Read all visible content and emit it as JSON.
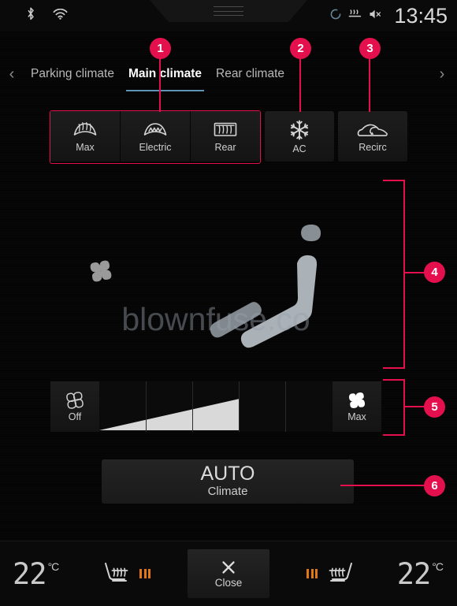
{
  "status_bar": {
    "bluetooth_icon": "bluetooth-icon",
    "wifi_icon": "wifi-icon",
    "circle_icon": "circle-progress-icon",
    "defrost_icon": "rear-defrost-icon",
    "mute_icon": "volume-muted-icon",
    "clock": "13:45",
    "handle_icon": "drag-handle-icon"
  },
  "tab_bar": {
    "prev_arrow": "‹",
    "next_arrow": "›",
    "tabs": [
      {
        "label": "Parking climate",
        "active": false
      },
      {
        "label": "Main climate",
        "active": true
      },
      {
        "label": "Rear climate",
        "active": false
      }
    ]
  },
  "mode_buttons": {
    "group_defrost": [
      {
        "label": "Max",
        "icon": "max-defrost-icon"
      },
      {
        "label": "Electric",
        "icon": "electric-defrost-icon"
      },
      {
        "label": "Rear",
        "icon": "rear-window-defrost-icon"
      }
    ],
    "ac": {
      "label": "AC",
      "icon": "snowflake-icon"
    },
    "recirc": {
      "label": "Recirc",
      "icon": "air-recirculation-icon"
    }
  },
  "airflow": {
    "fan_icon": "fan-icon",
    "seat_icon": "seat-silhouette-icon",
    "stream_count": 3,
    "watermark": "blownfuse.co"
  },
  "fan_slider": {
    "off_label": "Off",
    "off_icon": "fan-outline-icon",
    "max_label": "Max",
    "max_icon": "fan-solid-icon",
    "segments": 5,
    "filled_segments": 3
  },
  "auto_button": {
    "title": "AUTO",
    "subtitle": "Climate"
  },
  "bottom_bar": {
    "left_temp": "22",
    "left_unit": "°C",
    "right_temp": "22",
    "right_unit": "°C",
    "left_seat_icon": "heated-seat-left-icon",
    "right_seat_icon": "heated-seat-right-icon",
    "left_seat_level": 3,
    "right_seat_level": 3,
    "close_label": "Close",
    "close_icon": "close-x-icon"
  },
  "callouts": [
    {
      "number": "1"
    },
    {
      "number": "2"
    },
    {
      "number": "3"
    },
    {
      "number": "4"
    },
    {
      "number": "5"
    },
    {
      "number": "6"
    }
  ],
  "colors": {
    "accent": "#e4104e",
    "tab_underline": "#5d93b4",
    "seat_heat": "#e07818",
    "airflow": "#5b7f94"
  }
}
